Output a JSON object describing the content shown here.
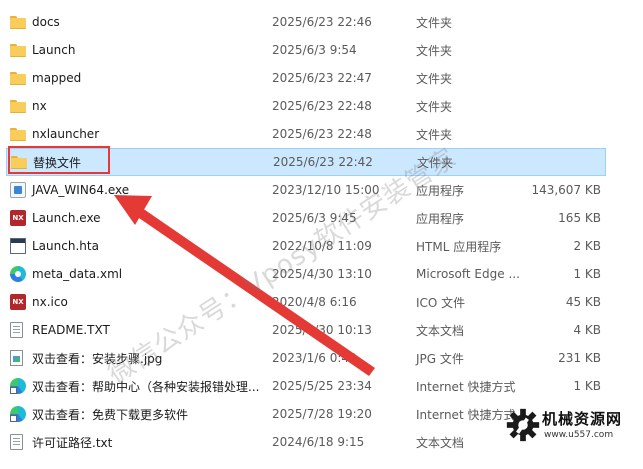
{
  "files": [
    {
      "name": "docs",
      "date": "2025/6/23 22:46",
      "type": "文件夹",
      "size": "",
      "icon": "folder-icon"
    },
    {
      "name": "Launch",
      "date": "2025/6/3 9:54",
      "type": "文件夹",
      "size": "",
      "icon": "folder-icon"
    },
    {
      "name": "mapped",
      "date": "2025/6/23 22:47",
      "type": "文件夹",
      "size": "",
      "icon": "folder-icon"
    },
    {
      "name": "nx",
      "date": "2025/6/23 22:48",
      "type": "文件夹",
      "size": "",
      "icon": "folder-icon"
    },
    {
      "name": "nxlauncher",
      "date": "2025/6/23 22:48",
      "type": "文件夹",
      "size": "",
      "icon": "folder-icon"
    },
    {
      "name": "替换文件",
      "date": "2025/6/23 22:42",
      "type": "文件夹",
      "size": "",
      "icon": "folder-icon",
      "selected": true
    },
    {
      "name": "JAVA_WIN64.exe",
      "date": "2023/12/10 15:00",
      "type": "应用程序",
      "size": "143,607 KB",
      "icon": "exe-icon"
    },
    {
      "name": "Launch.exe",
      "date": "2025/6/3 9:45",
      "type": "应用程序",
      "size": "165 KB",
      "icon": "nx-icon"
    },
    {
      "name": "Launch.hta",
      "date": "2022/10/8 11:09",
      "type": "HTML 应用程序",
      "size": "2 KB",
      "icon": "hta-icon"
    },
    {
      "name": "meta_data.xml",
      "date": "2025/4/30 13:10",
      "type": "Microsoft Edge ...",
      "size": "1 KB",
      "icon": "edge-icon"
    },
    {
      "name": "nx.ico",
      "date": "2020/4/8 6:16",
      "type": "ICO 文件",
      "size": "45 KB",
      "icon": "nx-icon"
    },
    {
      "name": "README.TXT",
      "date": "2025/5/30 10:13",
      "type": "文本文档",
      "size": "4 KB",
      "icon": "txt-icon"
    },
    {
      "name": "双击查看：安装步骤.jpg",
      "date": "2023/1/6 0:40",
      "type": "JPG 文件",
      "size": "231 KB",
      "icon": "jpg-icon"
    },
    {
      "name": "双击查看：帮助中心（各种安装报错处理...",
      "date": "2025/5/25 23:34",
      "type": "Internet 快捷方式",
      "size": "1 KB",
      "icon": "url-icon"
    },
    {
      "name": "双击查看：免费下载更多软件",
      "date": "2025/7/28 19:20",
      "type": "Internet 快捷方式",
      "size": "",
      "icon": "url-icon"
    },
    {
      "name": "许可证路径.txt",
      "date": "2024/6/18 9:15",
      "type": "文本文档",
      "size": "",
      "icon": "txt-icon"
    }
  ],
  "nx_icon_text": "NX",
  "watermark": "微信公众号：Vposy软件安装管家",
  "site": {
    "title": "机械资源网",
    "url": "www.u557.com"
  },
  "colors": {
    "selection_bg": "#cce8ff",
    "selection_border": "#99d1ff",
    "annotation_red": "#e53935"
  }
}
